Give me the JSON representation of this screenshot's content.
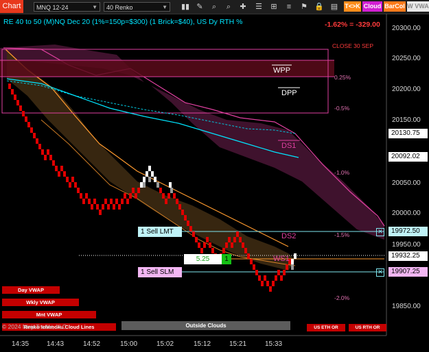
{
  "toolbar": {
    "chart_label": "Chart",
    "instrument": "MNQ 12-24",
    "bar_type": "40 Renko",
    "btn_tk": "T<>K",
    "btn_cloud": "Cloud",
    "btn_barcol": "BarCol",
    "btn_vwap": "W VWA",
    "icons": [
      "bar-chart-icon",
      "draw-icon",
      "zoom-in-icon",
      "zoom-out-icon",
      "plus-icon",
      "chart-style-icon",
      "properties-icon",
      "sliders-icon",
      "flag-icon",
      "lock-icon",
      "indicator-icon"
    ]
  },
  "chart_header": {
    "title": "RE 40 to 50 (M)NQ Dec 20 (1%=150p=$300) (1 Brick=$40), US Dy RTH %",
    "pnl": "-1.62% = -329.00"
  },
  "annotations": {
    "close_label": "CLOSE 30 SEP",
    "wpp": "WPP",
    "dpp": "DPP",
    "ds1": "DS1",
    "ds2": "DS2",
    "ws1": "WS1",
    "pct_levels": [
      "0.25%",
      "-0.5%",
      "-1.0%",
      "-1.5%",
      "-2.0%"
    ]
  },
  "y_axis": {
    "ticks": [
      "20300.00",
      "20250.00",
      "20200.00",
      "20150.00",
      "20050.00",
      "20000.00",
      "19950.00",
      "19850.00"
    ],
    "price_tags": {
      "p1": "20130.75",
      "p2": "20092.02",
      "p3": "19972.50",
      "p4": "19932.25",
      "p5": "19907.25"
    }
  },
  "x_axis": {
    "ticks": [
      "14:35",
      "14:43",
      "14:52",
      "15:00",
      "15:02",
      "15:12",
      "15:21",
      "15:33"
    ]
  },
  "orders": {
    "sell_lmt": "1 Sell LMT",
    "sell_slm": "1 Sell SLM",
    "position_value": "5.25",
    "position_qty": "1"
  },
  "legend": {
    "day_vwap": "Day VWAP",
    "wkly_vwap": "Wkly VWAP",
    "mnt_vwap": "Mnt VWAP",
    "cloud_lines": "Renko Ichimoku Cloud Lines",
    "copyright": "© 2024 NinjaTrader, LLC",
    "outside_clouds": "Outside Clouds",
    "us_eth_or": "US ETH OR",
    "us_rth_or": "US RTH OR"
  },
  "colors": {
    "cyan": "#00e5ff",
    "magenta": "#e040a0",
    "orange": "#ff9a2e",
    "red_brick": "#e00000",
    "white_brick": "#ffffff",
    "order_box": "#7fe7f0",
    "order_slm": "#e49be4"
  }
}
